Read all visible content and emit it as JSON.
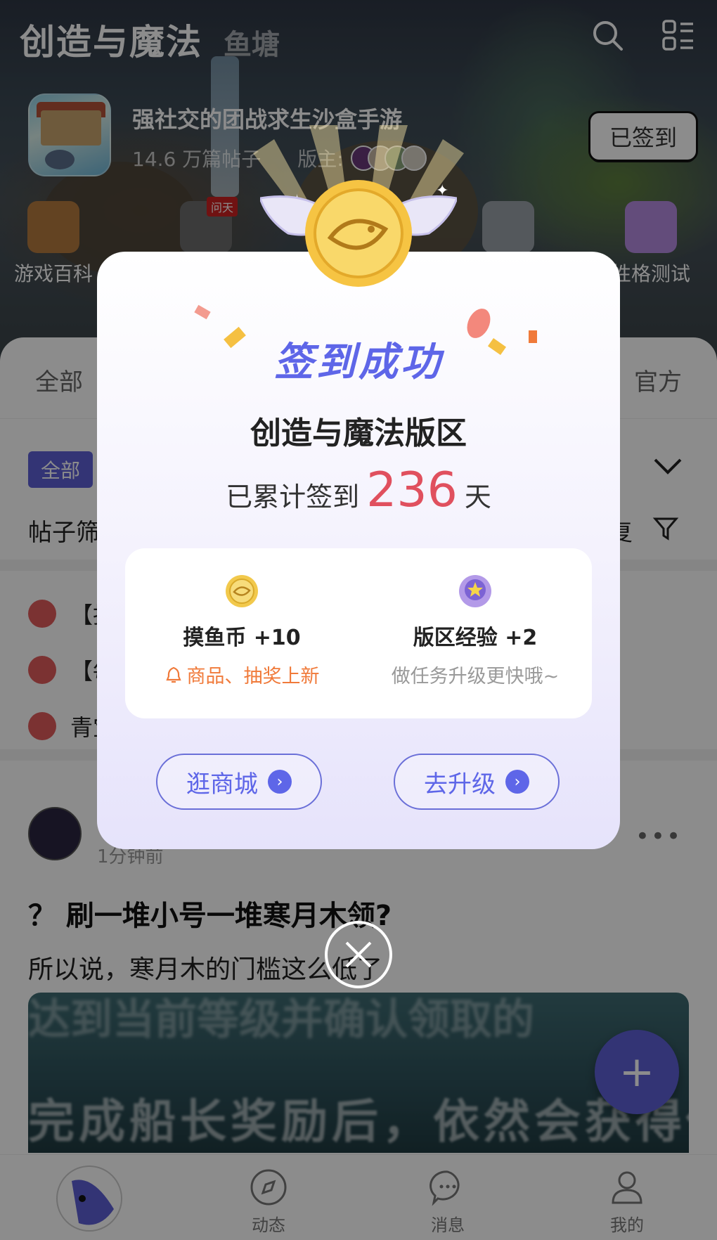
{
  "header": {
    "app_title": "创造与魔法",
    "tab_secondary": "鱼塘",
    "forum_desc": "强社交的团战求生沙盒手游",
    "post_count": "14.6 万篇帖子",
    "moderator_label": "版主:",
    "signed_label": "已签到",
    "shortcuts": [
      {
        "label": "游戏百科",
        "icon": "book-icon"
      },
      {
        "label": "",
        "icon": "pickaxe-icon",
        "badge": "问天"
      },
      {
        "label": "",
        "icon": "calculator-icon"
      },
      {
        "label": "性格测试",
        "icon": "quiz-icon"
      }
    ]
  },
  "tabs": {
    "all": "全部",
    "official": "官方"
  },
  "filters": {
    "chip_all": "全部",
    "filter_label": "帖子筛",
    "reply_label": "复"
  },
  "pinned": [
    "【抖",
    "【每",
    "青宝"
  ],
  "post": {
    "time": "1分钟前",
    "title": "？ 刷一堆小号一堆寒月木领?",
    "text": "所以说，寒月木的门槛这么低了",
    "image_text_top": "达到当前等级并确认领取的",
    "image_text": "完成船长奖励后，依然会获得你"
  },
  "modal": {
    "title": "签到成功",
    "forum_name": "创造与魔法版区",
    "streak_prefix": "已累计签到",
    "streak_days": "236",
    "streak_suffix": "天",
    "rewards": [
      {
        "title": "摸鱼币 +10",
        "sub": "商品、抽奖上新",
        "icon": "fish-coin-icon",
        "sub_icon": "bell-icon"
      },
      {
        "title": "版区经验 +2",
        "sub": "做任务升级更快哦~",
        "icon": "star-badge-icon"
      }
    ],
    "btn_shop": "逛商城",
    "btn_upgrade": "去升级"
  },
  "fab": "+",
  "bottom_nav": [
    {
      "label": "",
      "icon": "home-fish-icon"
    },
    {
      "label": "动态",
      "icon": "compass-icon"
    },
    {
      "label": "消息",
      "icon": "message-icon"
    },
    {
      "label": "我的",
      "icon": "user-icon"
    }
  ],
  "colors": {
    "accent": "#5d5fd6",
    "streak": "#e0505e",
    "orange": "#f07a3a"
  }
}
